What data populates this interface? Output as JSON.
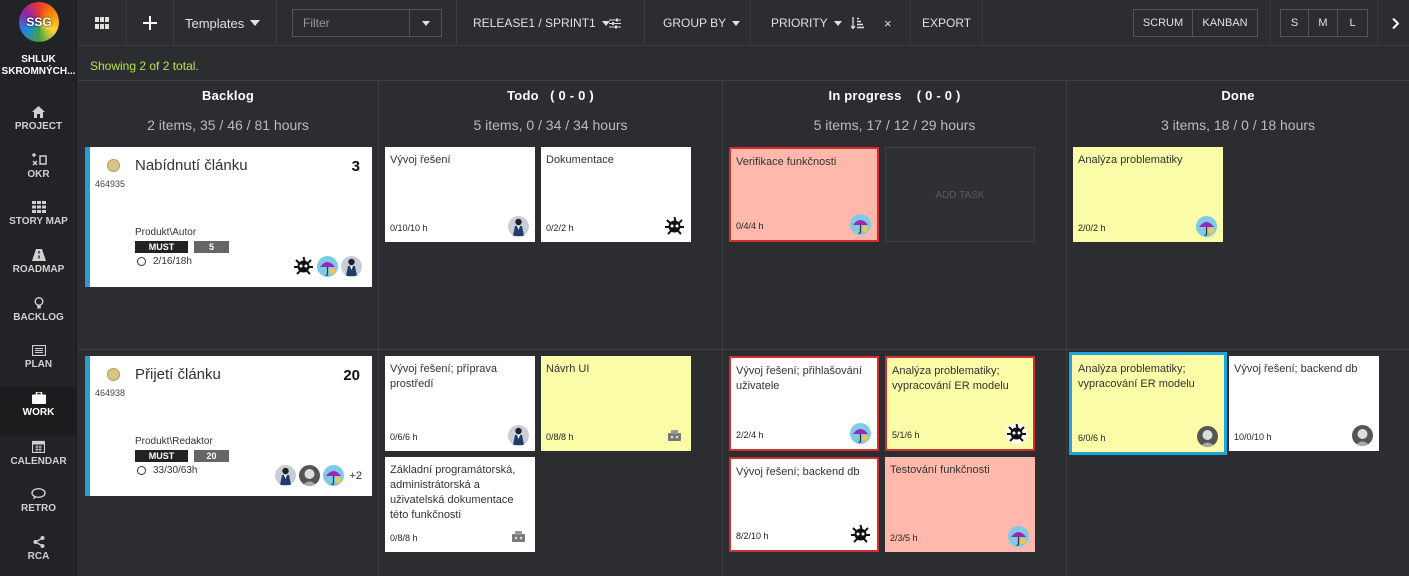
{
  "sidebar": {
    "logo": "SSG",
    "team_line1": "SHLUK",
    "team_line2": "SKROMNÝCH...",
    "items": [
      {
        "label": "PROJECT",
        "icon": "home-icon"
      },
      {
        "label": "OKR",
        "icon": "okr-icon"
      },
      {
        "label": "STORY MAP",
        "icon": "grid-icon"
      },
      {
        "label": "ROADMAP",
        "icon": "road-icon"
      },
      {
        "label": "BACKLOG",
        "icon": "lightbulb-icon"
      },
      {
        "label": "PLAN",
        "icon": "list-icon"
      },
      {
        "label": "WORK",
        "icon": "briefcase-icon"
      },
      {
        "label": "CALENDAR",
        "icon": "calendar-icon"
      },
      {
        "label": "RETRO",
        "icon": "chat-icon"
      },
      {
        "label": "RCA",
        "icon": "share-icon"
      }
    ],
    "active": "WORK"
  },
  "toolbar": {
    "templates_label": "Templates",
    "filter_placeholder": "Filter",
    "release_label": "RELEASE1 / SPRINT1",
    "group_by_label": "GROUP BY",
    "priority_label": "PRIORITY",
    "clear_label": "×",
    "export_label": "EXPORT",
    "mode": [
      "SCRUM",
      "KANBAN"
    ],
    "sizes": [
      "S",
      "M",
      "L"
    ]
  },
  "status": "Showing 2 of 2 total.",
  "columns": [
    {
      "title": "Backlog",
      "summary": "2 items, 35 / 46 / 81 hours"
    },
    {
      "title": "Todo   ( 0 - 0 )",
      "summary": "5 items, 0 / 34 / 34 hours"
    },
    {
      "title": "In progress    ( 0 - 0 )",
      "summary": "5 items, 17 / 12 / 29 hours"
    },
    {
      "title": "Done",
      "summary": "3 items, 18 / 0 / 18 hours"
    }
  ],
  "stories": [
    {
      "title": "Nabídnutí článku",
      "points": "3",
      "id": "464935",
      "path": "Produkt\\Autor",
      "priority": "MUST",
      "estimate": "5",
      "time": "2/16/18h",
      "more": ""
    },
    {
      "title": "Přijetí článku",
      "points": "20",
      "id": "464938",
      "path": "Produkt\\Redaktor",
      "priority": "MUST",
      "estimate": "20",
      "time": "33/30/63h",
      "more": "+2"
    }
  ],
  "tasks": {
    "r1_todo_1": {
      "text": "Vývoj řešení",
      "hours": "0/10/10 h"
    },
    "r1_todo_2": {
      "text": "Dokumentace",
      "hours": "0/2/2 h"
    },
    "r1_prog_1": {
      "text": "Verifikace funkčnosti",
      "hours": "0/4/4 h"
    },
    "r1_add": "ADD TASK",
    "r1_done_1": {
      "text": "Analýza problematiky",
      "hours": "2/0/2 h"
    },
    "r2_todo_1": {
      "text": "Vývoj řešení; příprava prostředí",
      "hours": "0/6/6 h"
    },
    "r2_todo_2": {
      "text": "Návrh UI",
      "hours": "0/8/8 h"
    },
    "r2_todo_3": {
      "text": "Základní programátorská, administrátorská a uživatelská dokumentace této funkčnosti",
      "hours": "0/8/8 h"
    },
    "r2_prog_1": {
      "text": "Vývoj řešení; přihlašování uživatele",
      "hours": "2/2/4 h"
    },
    "r2_prog_2": {
      "text": "Analýza problematiky; vypracování ER modelu",
      "hours": "5/1/6 h"
    },
    "r2_prog_3": {
      "text": "Vývoj řešení; backend db",
      "hours": "8/2/10 h"
    },
    "r2_prog_4": {
      "text": "Testování funkčnosti",
      "hours": "2/3/5 h"
    },
    "r2_done_1": {
      "text": "Analýza problematiky; vypracování ER modelu",
      "hours": "6/0/6 h"
    },
    "r2_done_2": {
      "text": "Vývoj řešení; backend db",
      "hours": "10/0/10 h"
    }
  },
  "colors": {
    "accent_blue": "#2b9bd6",
    "status_green": "#b8e34a",
    "task_yellow": "#fbfca7",
    "task_pink": "#ffb8ab",
    "alert_red": "#d32f2f",
    "selected_blue": "#1ea5e0"
  }
}
